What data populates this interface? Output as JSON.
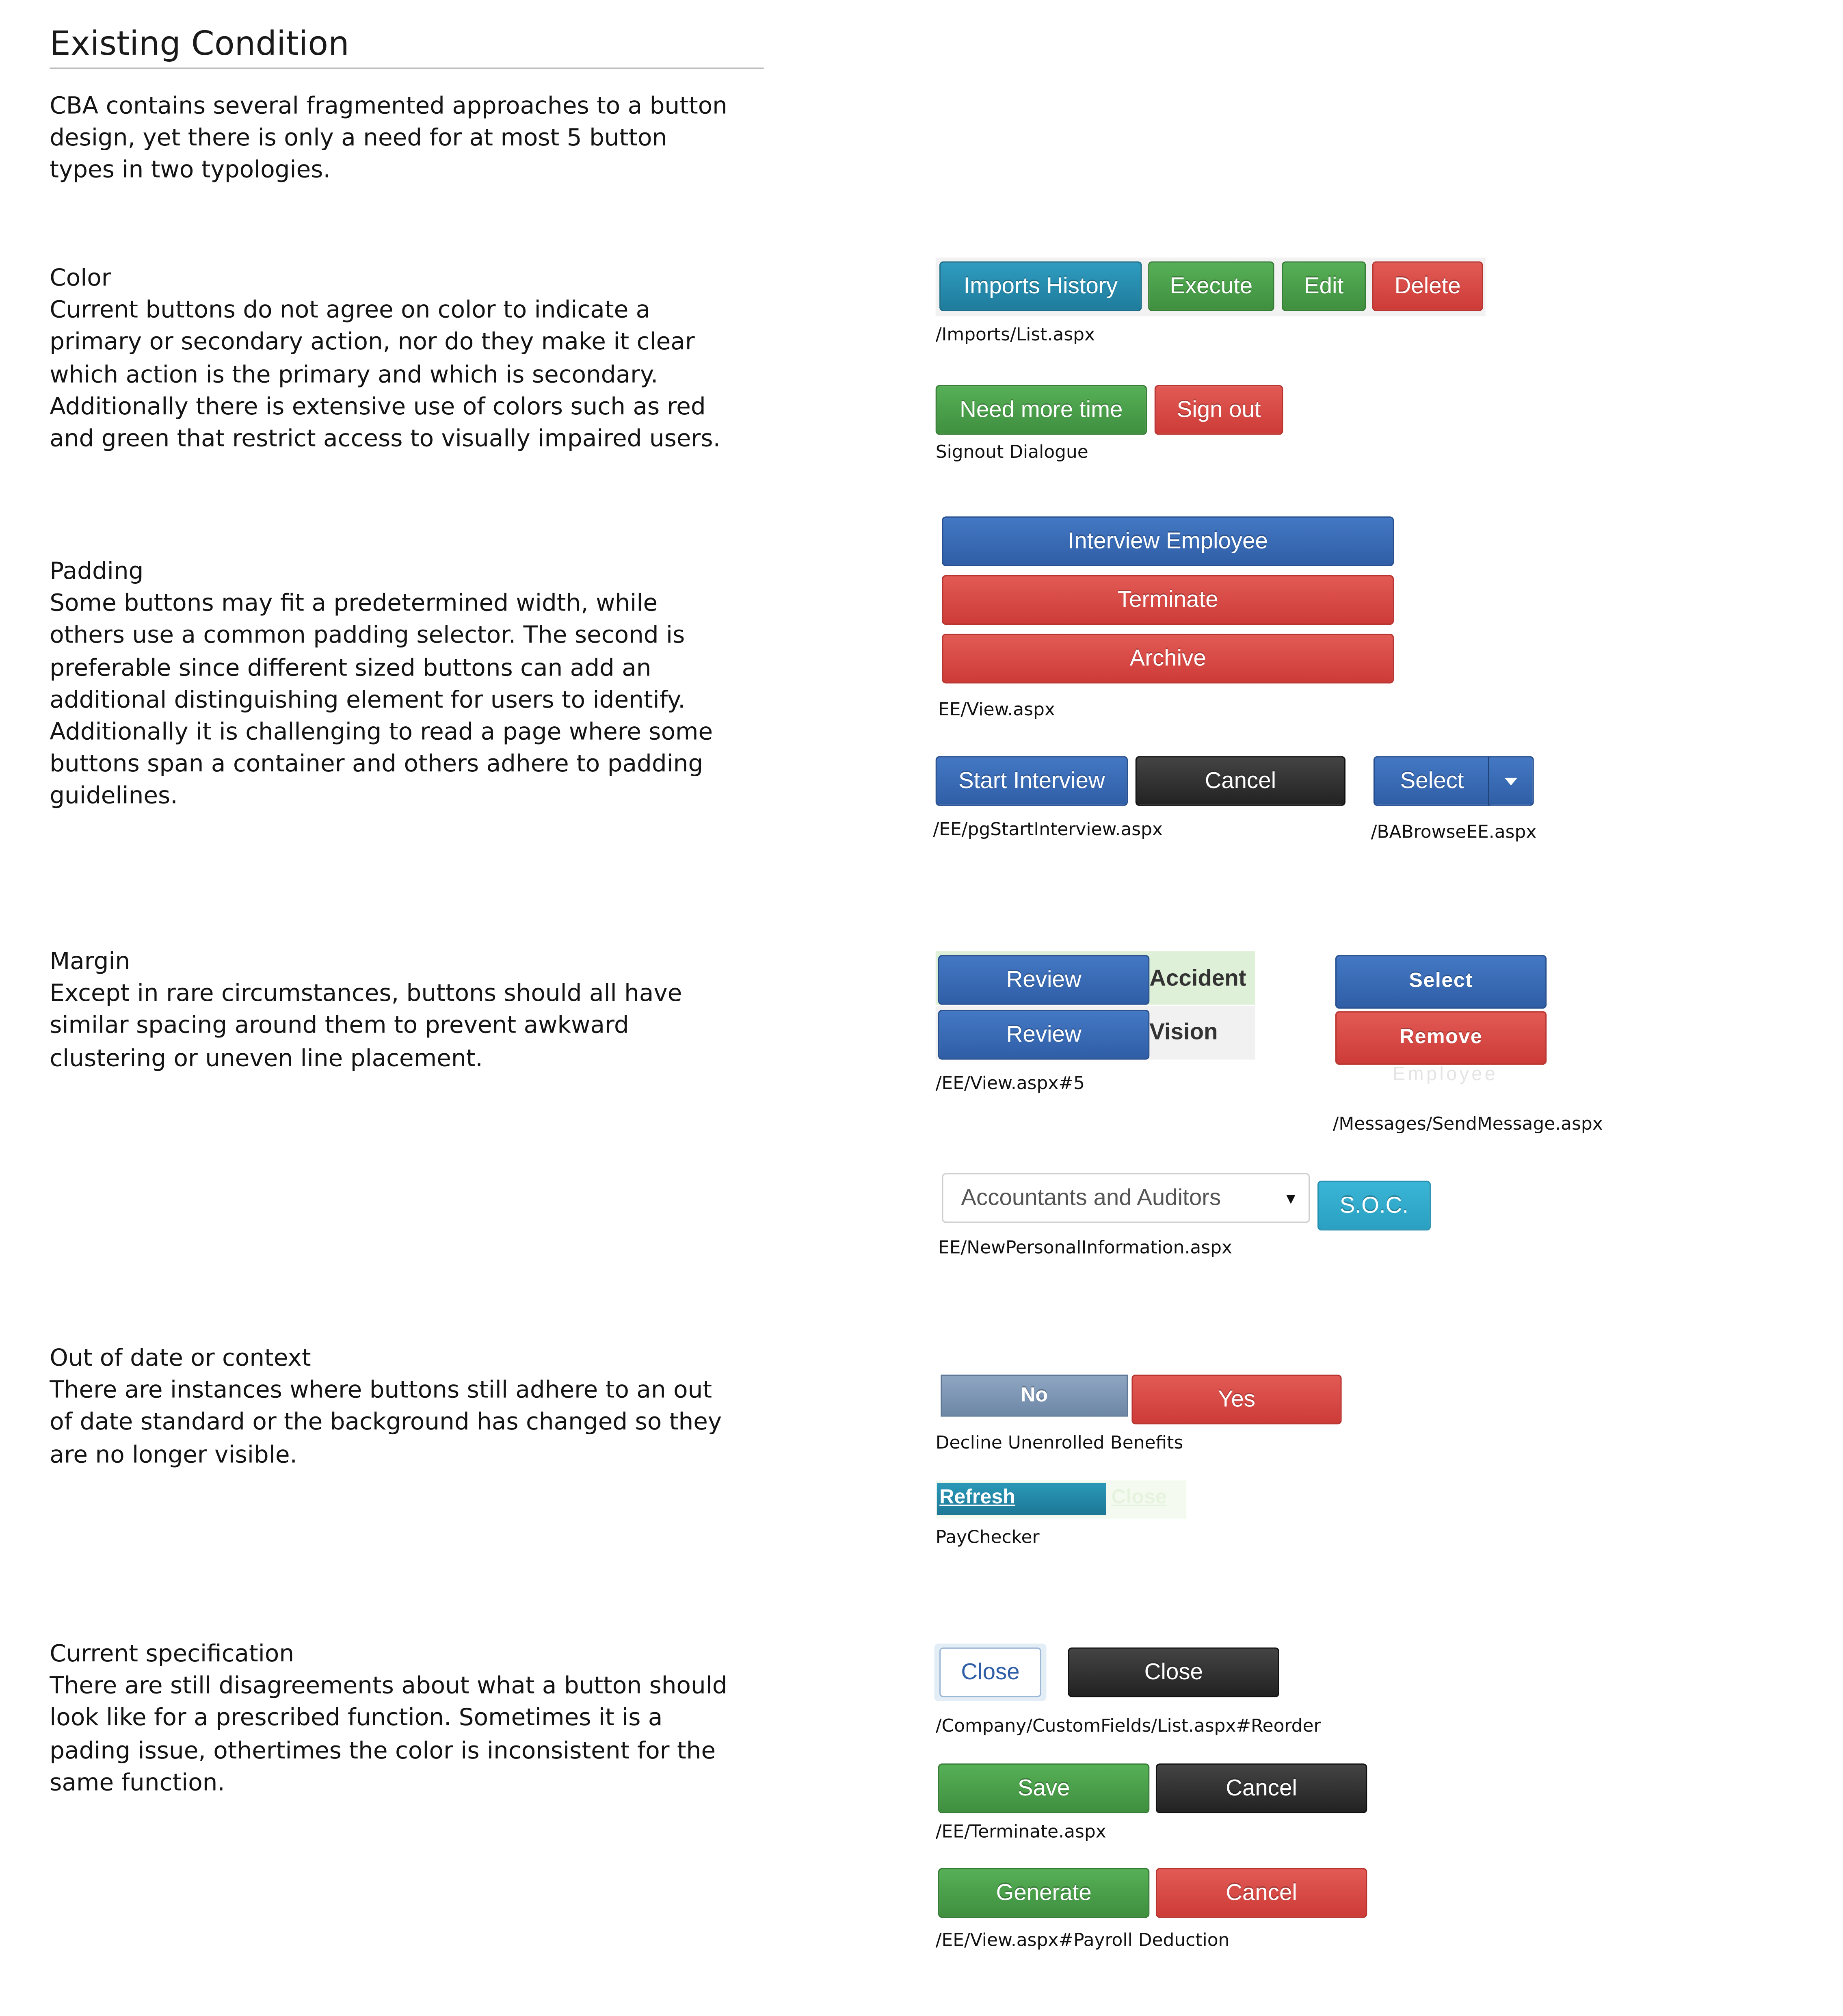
{
  "title": "Existing Condition",
  "intro": "CBA contains several fragmented approaches to a button design, yet there is only a need for at most 5 button types in two typologies.",
  "sections": {
    "color": {
      "heading": "Color",
      "body": "Current buttons do not agree on color to indicate a primary or secondary action, nor do they make it clear which action is the primary and which is secondary. Additionally there is extensive use of colors such as red and green that restrict access to visually impaired users."
    },
    "padding": {
      "heading": "Padding",
      "body": "Some buttons may fit a predetermined width, while others use a common padding selector. The second is preferable since different sized buttons can add an additional distinguishing element for users to identify. Additionally it is challenging to read a page where some buttons span a container and others adhere to padding guidelines."
    },
    "margin": {
      "heading": "Margin",
      "body": "Except in rare circumstances, buttons should all have similar spacing around them to prevent awkward clustering or uneven line placement."
    },
    "outdated": {
      "heading": "Out of date or context",
      "body": "There are instances where buttons still adhere to an out of date standard or the background has changed so they are no longer visible."
    },
    "spec": {
      "heading": "Current specification",
      "body": "There are still disagreements about what a button should look like for a prescribed function. Sometimes it is a pading issue, othertimes the color is inconsistent for the same function."
    }
  },
  "examples": {
    "imports": {
      "buttons": [
        "Imports History",
        "Execute",
        "Edit",
        "Delete"
      ],
      "caption": "/Imports/List.aspx"
    },
    "signout": {
      "buttons": [
        "Need more time",
        "Sign out"
      ],
      "caption": "Signout Dialogue"
    },
    "ee_view": {
      "buttons": [
        "Interview Employee",
        "Terminate",
        "Archive"
      ],
      "caption": "EE/View.aspx"
    },
    "start_interview": {
      "buttons": [
        "Start Interview",
        "Cancel"
      ],
      "caption": "/EE/pgStartInterview.aspx"
    },
    "browse": {
      "button": "Select",
      "caption": "/BABrowseEE.aspx"
    },
    "ee_view5": {
      "rows": [
        {
          "button": "Review",
          "label": "Accident"
        },
        {
          "button": "Review",
          "label": "Vision"
        }
      ],
      "caption": "/EE/View.aspx#5"
    },
    "messages": {
      "buttons": [
        "Select",
        "Remove"
      ],
      "faded_text": "Employee",
      "caption": "/Messages/SendMessage.aspx"
    },
    "personal": {
      "select_value": "Accountants and Auditors",
      "button": "S.O.C.",
      "caption": "EE/NewPersonalInformation.aspx"
    },
    "decline": {
      "buttons": [
        "No",
        "Yes"
      ],
      "caption": "Decline Unenrolled Benefits"
    },
    "paychecker": {
      "links": [
        "Refresh",
        "Close"
      ],
      "caption": "PayChecker"
    },
    "reorder": {
      "buttons": [
        "Close",
        "Close"
      ],
      "caption": "/Company/CustomFields/List.aspx#Reorder"
    },
    "terminate": {
      "buttons": [
        "Save",
        "Cancel"
      ],
      "caption": "/EE/Terminate.aspx"
    },
    "payroll": {
      "buttons": [
        "Generate",
        "Cancel"
      ],
      "caption": "/EE/View.aspx#Payroll Deduction"
    }
  },
  "colors": {
    "teal": "#2a8db0",
    "green": "#4a9f4a",
    "red": "#d8463f",
    "blue": "#3566b2",
    "black": "#2b2b2b",
    "soc": "#30aacc",
    "grayblue": "#7d96b4"
  }
}
